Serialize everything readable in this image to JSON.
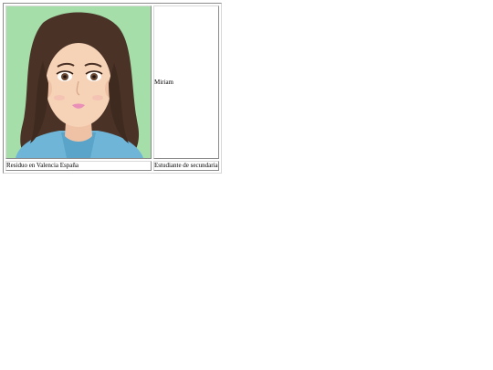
{
  "profile": {
    "name": "Miriam",
    "location": "Residuo en Valencia España",
    "occupation": "Estudiante de secundaria",
    "avatar_icon": "avatar-cartoon-girl-icon"
  },
  "colors": {
    "avatar_background": "#a6deaa",
    "hair": "#4a3227",
    "skin": "#f6d2b6",
    "shirt": "#6fb5d8",
    "lips": "#e98fb8"
  }
}
